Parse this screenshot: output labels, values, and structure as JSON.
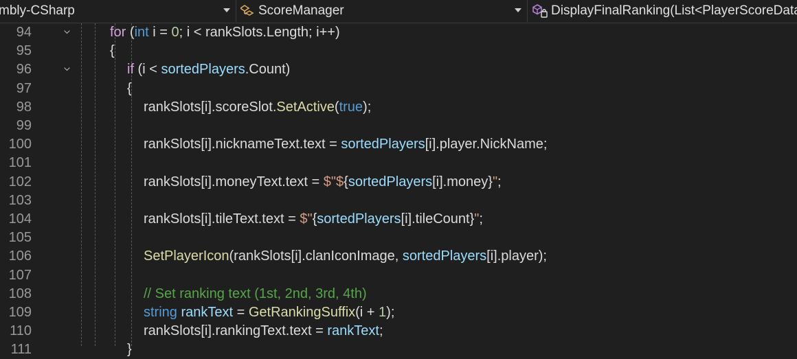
{
  "nav": {
    "project": "mbly-CSharp",
    "class_name": "ScoreManager",
    "member": "DisplayFinalRanking(List<PlayerScoreData"
  },
  "editor": {
    "lines": [
      {
        "n": "94",
        "indent": 160,
        "fold": true,
        "tokens": [
          [
            "ctl",
            "for"
          ],
          [
            "ident",
            " ("
          ],
          [
            "kw",
            "int"
          ],
          [
            "ident",
            " i = "
          ],
          [
            "num",
            "0"
          ],
          [
            "ident",
            "; i < rankSlots.Length; i++)"
          ]
        ]
      },
      {
        "n": "95",
        "indent": 160,
        "fold": false,
        "tokens": [
          [
            "ident",
            "{"
          ]
        ]
      },
      {
        "n": "96",
        "indent": 185,
        "fold": true,
        "tokens": [
          [
            "ctl",
            "if"
          ],
          [
            "ident",
            " (i < "
          ],
          [
            "var",
            "sortedPlayers"
          ],
          [
            "ident",
            ".Count)"
          ]
        ]
      },
      {
        "n": "97",
        "indent": 185,
        "fold": false,
        "tokens": [
          [
            "ident",
            "{"
          ]
        ]
      },
      {
        "n": "98",
        "indent": 209,
        "fold": false,
        "tokens": [
          [
            "ident",
            "rankSlots[i].scoreSlot."
          ],
          [
            "mth",
            "SetActive"
          ],
          [
            "ident",
            "("
          ],
          [
            "kw",
            "true"
          ],
          [
            "ident",
            ");"
          ]
        ]
      },
      {
        "n": "99",
        "indent": 209,
        "fold": false,
        "tokens": []
      },
      {
        "n": "100",
        "indent": 209,
        "fold": false,
        "tokens": [
          [
            "ident",
            "rankSlots[i].nicknameText.text = "
          ],
          [
            "var",
            "sortedPlayers"
          ],
          [
            "ident",
            "[i].player.NickName;"
          ]
        ]
      },
      {
        "n": "101",
        "indent": 209,
        "fold": false,
        "tokens": []
      },
      {
        "n": "102",
        "indent": 209,
        "fold": false,
        "tokens": [
          [
            "ident",
            "rankSlots[i].moneyText.text = "
          ],
          [
            "str",
            "$\"$"
          ],
          [
            "ident",
            "{"
          ],
          [
            "var",
            "sortedPlayers"
          ],
          [
            "ident",
            "[i].money}"
          ],
          [
            "str",
            "\""
          ],
          [
            "ident",
            ";"
          ]
        ]
      },
      {
        "n": "103",
        "indent": 209,
        "fold": false,
        "tokens": []
      },
      {
        "n": "104",
        "indent": 209,
        "fold": false,
        "tokens": [
          [
            "ident",
            "rankSlots[i].tileText.text = "
          ],
          [
            "str",
            "$\""
          ],
          [
            "ident",
            "{"
          ],
          [
            "var",
            "sortedPlayers"
          ],
          [
            "ident",
            "[i].tileCount}"
          ],
          [
            "str",
            "\""
          ],
          [
            "ident",
            ";"
          ]
        ]
      },
      {
        "n": "105",
        "indent": 209,
        "fold": false,
        "tokens": []
      },
      {
        "n": "106",
        "indent": 209,
        "fold": false,
        "tokens": [
          [
            "mth",
            "SetPlayerIcon"
          ],
          [
            "ident",
            "(rankSlots[i].clanIconImage, "
          ],
          [
            "var",
            "sortedPlayers"
          ],
          [
            "ident",
            "[i].player);"
          ]
        ]
      },
      {
        "n": "107",
        "indent": 209,
        "fold": false,
        "tokens": []
      },
      {
        "n": "108",
        "indent": 209,
        "fold": false,
        "tokens": [
          [
            "cmt",
            "// Set ranking text (1st, 2nd, 3rd, 4th)"
          ]
        ]
      },
      {
        "n": "109",
        "indent": 209,
        "fold": false,
        "tokens": [
          [
            "kw",
            "string"
          ],
          [
            "ident",
            " "
          ],
          [
            "var",
            "rankText"
          ],
          [
            "ident",
            " = "
          ],
          [
            "mth",
            "GetRankingSuffix"
          ],
          [
            "ident",
            "(i + "
          ],
          [
            "num",
            "1"
          ],
          [
            "ident",
            ");"
          ]
        ]
      },
      {
        "n": "110",
        "indent": 209,
        "fold": false,
        "tokens": [
          [
            "ident",
            "rankSlots[i].rankingText.text = "
          ],
          [
            "var",
            "rankText"
          ],
          [
            "ident",
            ";"
          ]
        ]
      },
      {
        "n": "111",
        "indent": 185,
        "fold": false,
        "tokens": [
          [
            "ident",
            "}"
          ]
        ]
      }
    ]
  }
}
